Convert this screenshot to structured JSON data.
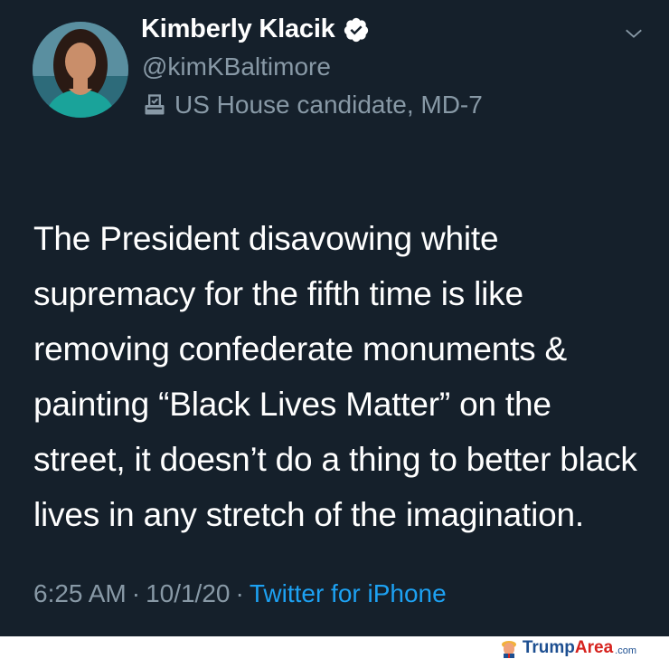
{
  "tweet": {
    "author_name": "Kimberly Klacik",
    "handle": "@kimKBaltimore",
    "bio_label": "US House candidate, MD-7",
    "text": "The President disavowing white supremacy for the fifth time is like removing confederate monuments & painting “Black Lives Matter” on the street, it doesn’t do a thing to better black lives in any stretch of the imagination.",
    "time": "6:25 AM",
    "separator": "·",
    "date": "10/1/20",
    "source": "Twitter for iPhone",
    "icons": {
      "verified": "verified-badge-icon",
      "bio": "ballot-box-icon",
      "menu": "chevron-down-icon"
    }
  },
  "watermark": {
    "text_part1": "Trump",
    "text_part2": "Area",
    "suffix": ".com"
  },
  "colors": {
    "background": "#15202b",
    "primary_text": "#ffffff",
    "secondary_text": "#8899a6",
    "link": "#1da1f2",
    "watermark_blue": "#1d4f91",
    "watermark_red": "#d6231e"
  }
}
